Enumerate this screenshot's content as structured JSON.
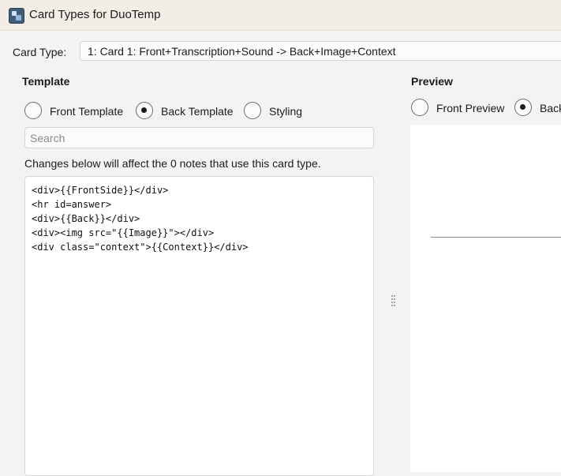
{
  "window": {
    "title": "Card Types for DuoTemp",
    "icon": "app-icon"
  },
  "card_type": {
    "label": "Card Type:",
    "selected": "1: Card 1: Front+Transcription+Sound -> Back+Image+Context"
  },
  "template": {
    "heading": "Template",
    "radios": [
      {
        "label": "Front Template",
        "checked": false
      },
      {
        "label": "Back Template",
        "checked": true
      },
      {
        "label": "Styling",
        "checked": false
      }
    ],
    "search_placeholder": "Search",
    "info": "Changes below will affect the 0 notes that use this card type.",
    "code": [
      "<div>{{FrontSide}}</div>",
      "<hr id=answer>",
      "<div>{{Back}}</div>",
      "<div><img src=\"{{Image}}\"></div>",
      "<div class=\"context\">{{Context}}</div>"
    ]
  },
  "preview": {
    "heading": "Preview",
    "radios": [
      {
        "label": "Front Preview",
        "checked": false
      },
      {
        "label": "Back",
        "checked": true
      }
    ]
  }
}
